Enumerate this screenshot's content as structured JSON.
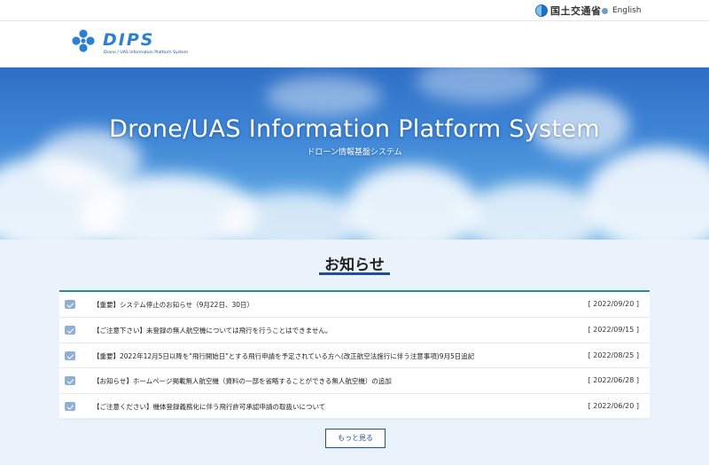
{
  "topbar": {
    "ministry": "国土交通省",
    "language_link": "English"
  },
  "logo": {
    "name": "DIPS",
    "tagline": "Drone / UAS Information Platform System"
  },
  "hero": {
    "title": "Drone/UAS Information Platform System",
    "subtitle": "ドローン情報基盤システム"
  },
  "news": {
    "heading": "お知らせ",
    "items": [
      {
        "title": "【重要】システム停止のお知らせ（9月22日、30日）",
        "date": "[ 2022/09/20 ]"
      },
      {
        "title": "【ご注意下さい】未登録の無人航空機については飛行を行うことはできません。",
        "date": "[ 2022/09/15 ]"
      },
      {
        "title": "【重要】2022年12月5日以降を\"飛行開始日\"とする飛行申請を予定されている方へ(改正航空法施行に伴う注意事項)9月5日追記",
        "date": "[ 2022/08/25 ]"
      },
      {
        "title": "【お知らせ】ホームページ掲載無人航空機（資料の一部を省略することができる無人航空機）の追加",
        "date": "[ 2022/06/28 ]"
      },
      {
        "title": "【ご注意ください】機体登録義務化に伴う飛行許可承認申請の取扱いについて",
        "date": "[ 2022/06/20 ]"
      }
    ],
    "more_label": "もっと見る"
  },
  "colors": {
    "brand_blue": "#1c4f9c",
    "logo_blue": "#2a7fd4",
    "list_accent": "#2a8a9e",
    "page_bg": "#eaf3fb"
  }
}
